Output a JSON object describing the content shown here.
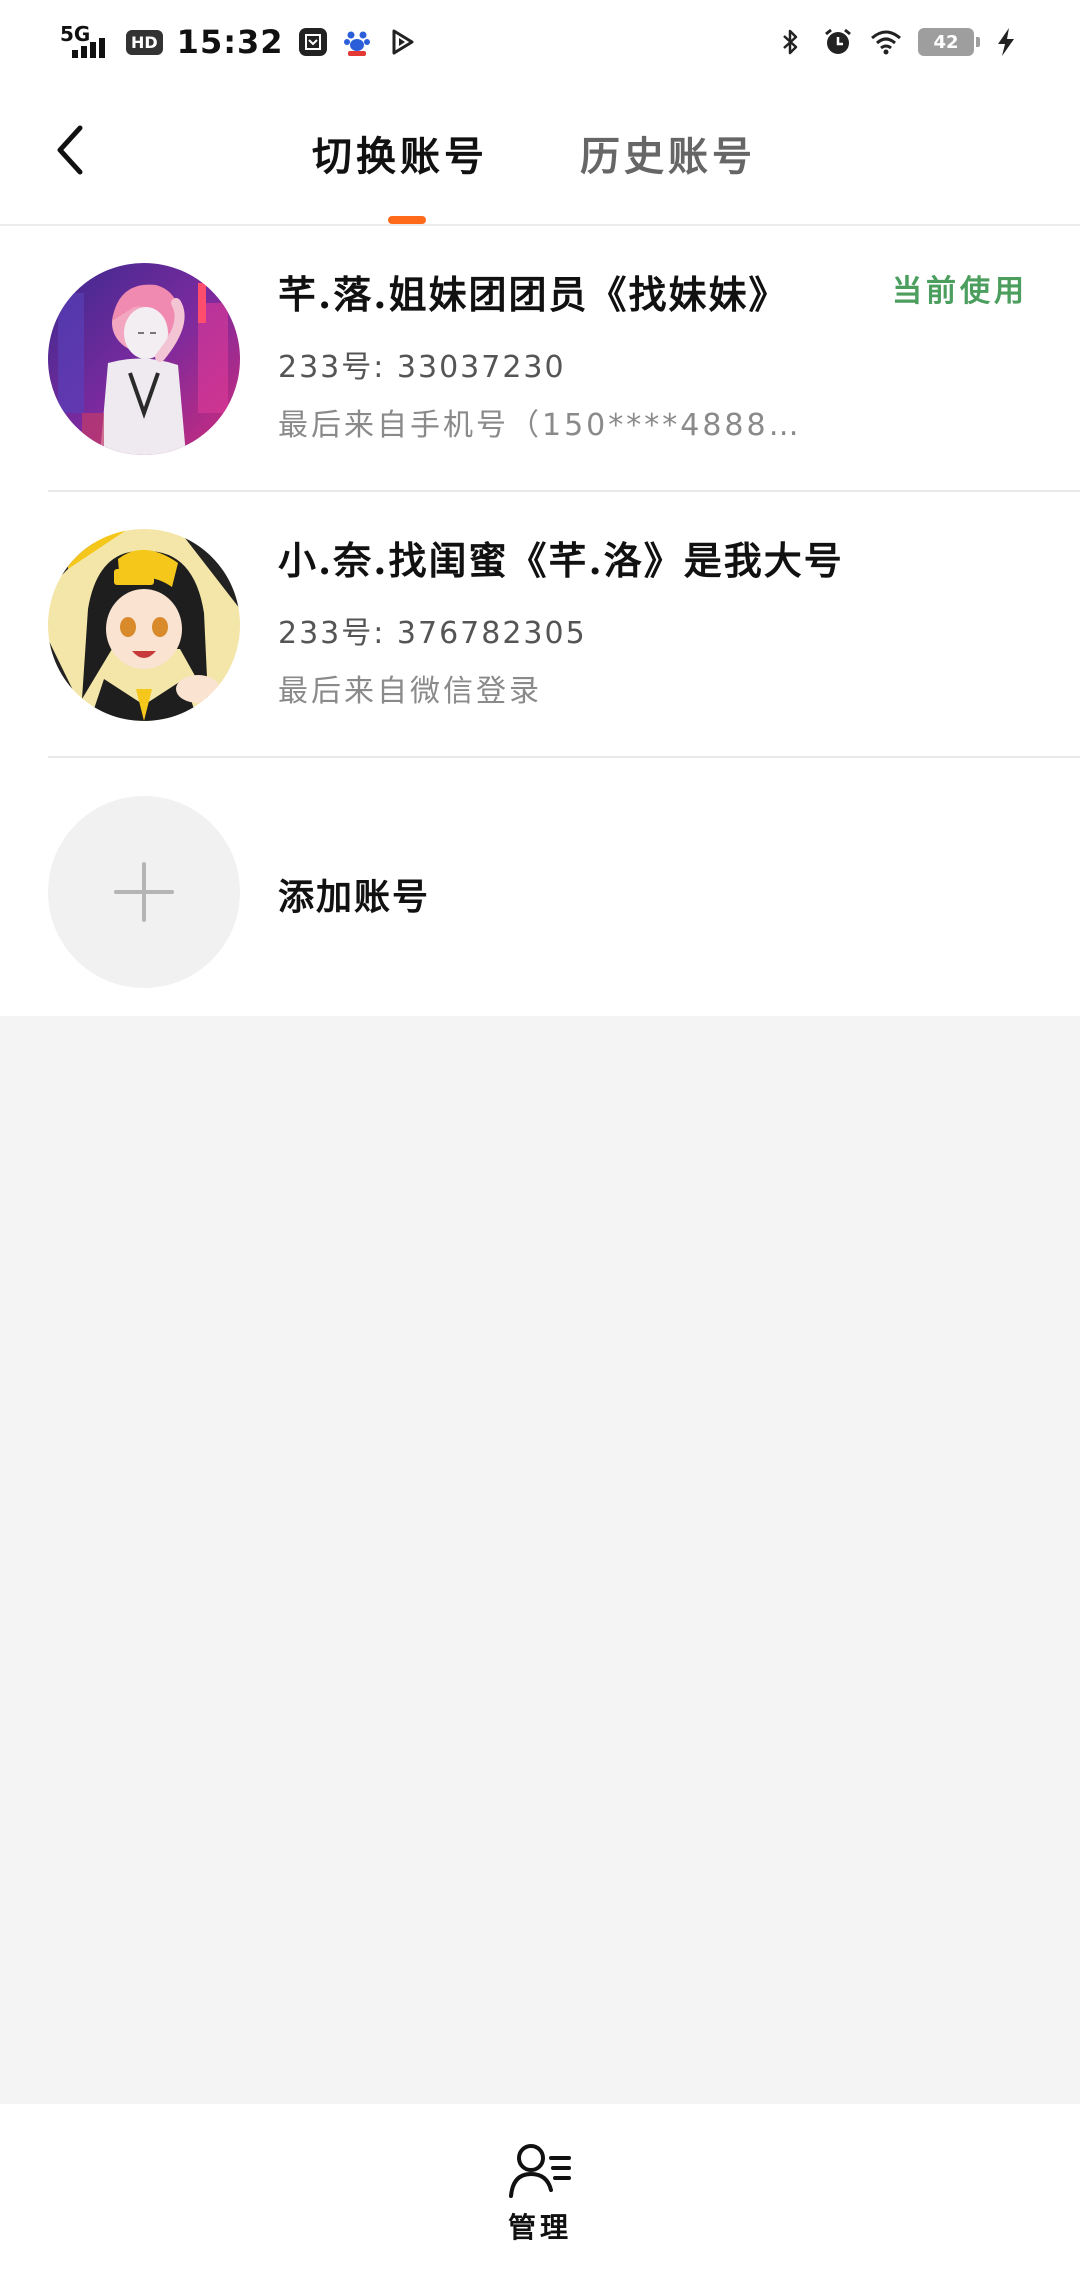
{
  "status_bar": {
    "network": "5G",
    "hd_badge": "HD",
    "time": "15:32",
    "battery": "42",
    "icons": [
      "signal-icon",
      "hd-icon",
      "app-icon",
      "baidu-icon",
      "play-icon",
      "bluetooth-icon",
      "alarm-icon",
      "wifi-icon",
      "battery-icon",
      "charging-icon"
    ]
  },
  "header": {
    "back_icon": "chevron-left-icon",
    "tabs": [
      {
        "label": "切换账号",
        "active": true
      },
      {
        "label": "历史账号",
        "active": false
      }
    ],
    "accent_color": "#ff6a1a"
  },
  "accounts": [
    {
      "name": "芊.落.姐妹团团员《找妹妹》",
      "id_text": "233号: 33037230",
      "sub_text": "最后来自手机号（150****4888…",
      "badge": "当前使用",
      "badge_color": "#4c9e5e"
    },
    {
      "name": "小.奈.找闺蜜《芊.洛》是我大号",
      "id_text": "233号: 376782305",
      "sub_text": "最后来自微信登录",
      "badge": ""
    }
  ],
  "add_account": {
    "label": "添加账号",
    "icon": "plus-icon"
  },
  "bottom_bar": {
    "manage_label": "管理",
    "manage_icon": "user-list-icon"
  }
}
